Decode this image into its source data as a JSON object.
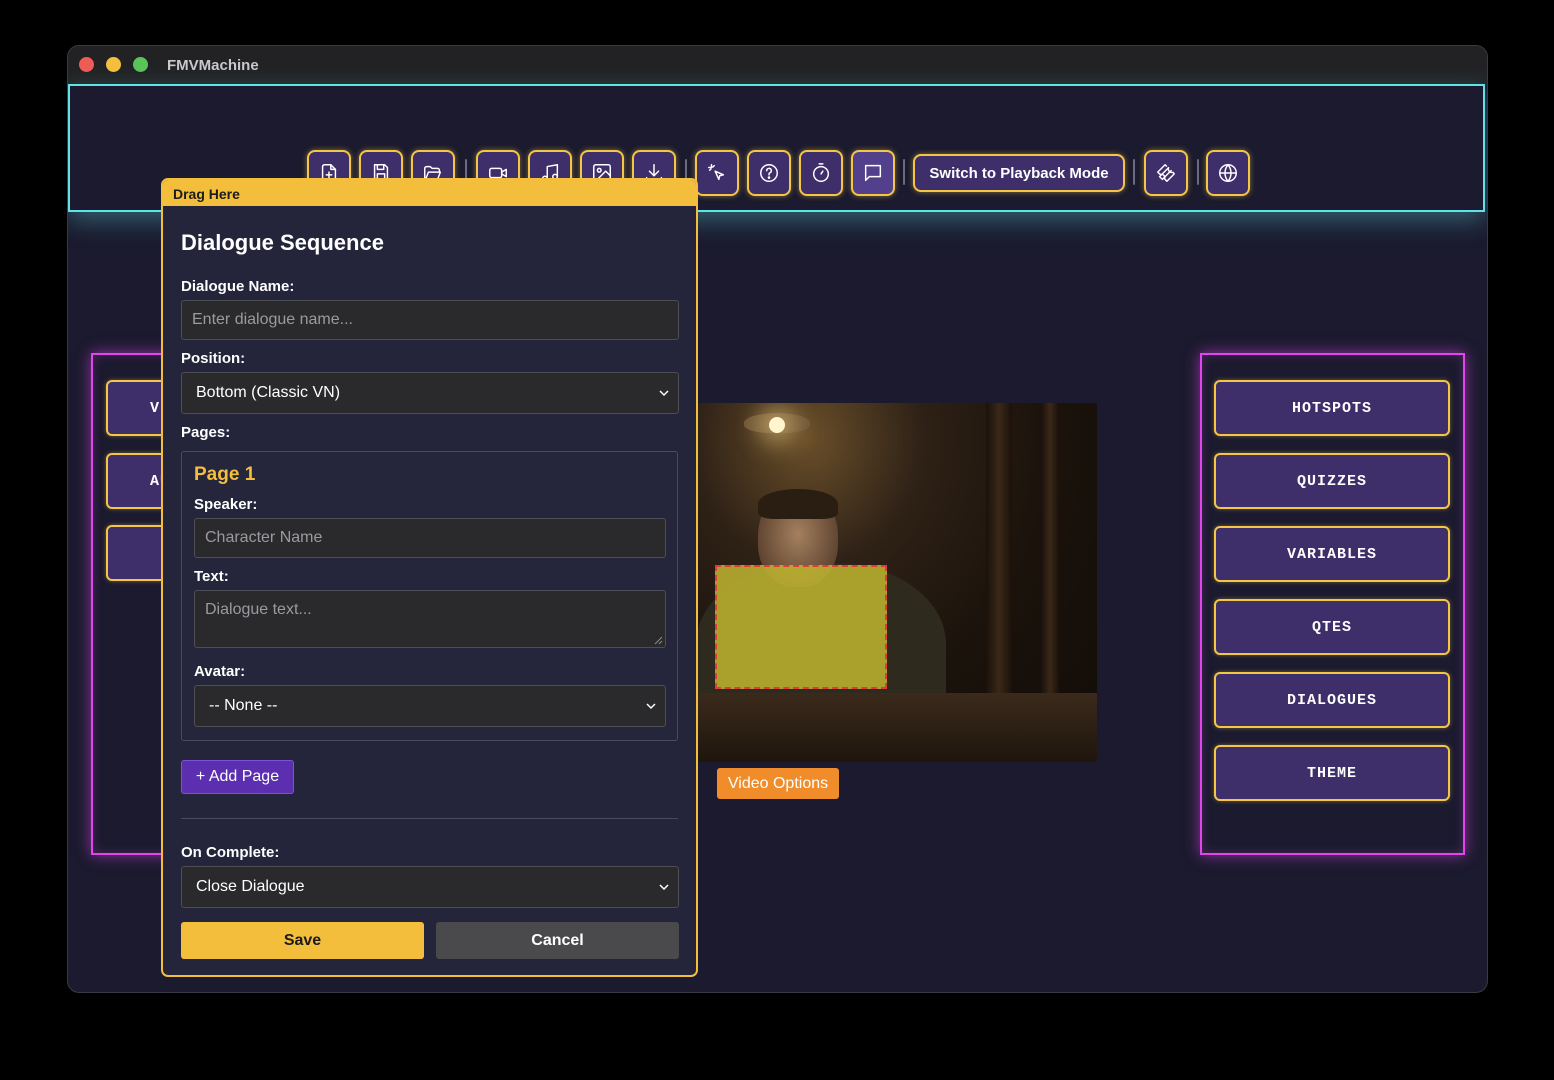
{
  "window": {
    "title": "FMVMachine"
  },
  "toolbar": {
    "icons": [
      "new-file-icon",
      "save-icon",
      "open-folder-icon",
      "video-icon",
      "music-icon",
      "image-icon",
      "download-icon",
      "magic-pointer-icon",
      "help-icon",
      "timer-icon",
      "chat-icon",
      "wrench-icon",
      "globe-icon"
    ],
    "playback_label": "Switch to Playback Mode",
    "accent": "#f3c646",
    "frame_color": "#5fe3e8"
  },
  "left_panel": {
    "items": [
      "VIDEOS",
      "AUDIO",
      ""
    ]
  },
  "right_panel": {
    "items": [
      "HOTSPOTS",
      "QUIZZES",
      "VARIABLES",
      "QTES",
      "DIALOGUES",
      "THEME"
    ],
    "glow_color": "#e046ec"
  },
  "video": {
    "options_label": "Video Options"
  },
  "dialog": {
    "drag_label": "Drag Here",
    "title": "Dialogue Sequence",
    "name_label": "Dialogue Name:",
    "name_placeholder": "Enter dialogue name...",
    "name_value": "",
    "position_label": "Position:",
    "position_value": "Bottom (Classic VN)",
    "pages_label": "Pages:",
    "page": {
      "title": "Page 1",
      "speaker_label": "Speaker:",
      "speaker_placeholder": "Character Name",
      "text_label": "Text:",
      "text_placeholder": "Dialogue text...",
      "avatar_label": "Avatar:",
      "avatar_value": "-- None --"
    },
    "add_page_label": "+ Add Page",
    "on_complete_label": "On Complete:",
    "on_complete_value": "Close Dialogue",
    "save_label": "Save",
    "cancel_label": "Cancel",
    "accent": "#f4be3d"
  }
}
